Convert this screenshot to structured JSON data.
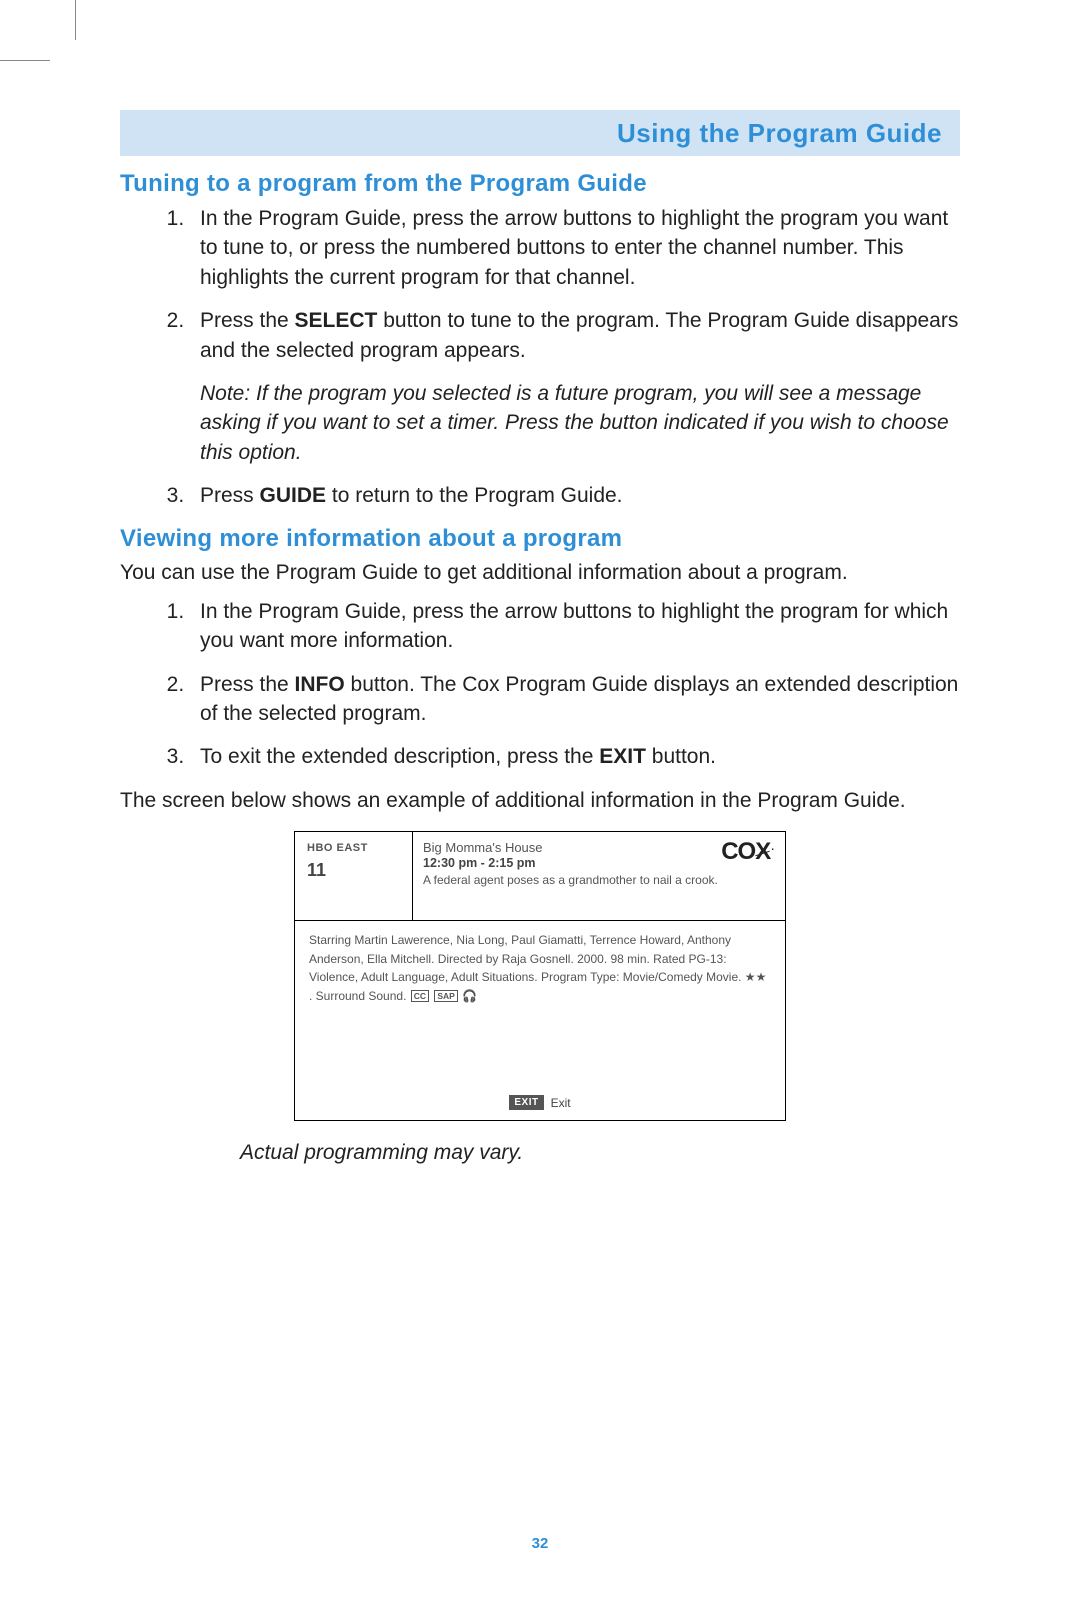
{
  "header": {
    "title": "Using the Program Guide"
  },
  "section1": {
    "heading": "Tuning to a program from the Program Guide",
    "step1": "In the Program Guide, press the arrow buttons to highlight the program you want to tune to, or press the numbered buttons to enter the channel number. This highlights the current program for that channel.",
    "step2_a": "Press the ",
    "step2_bold": "SELECT",
    "step2_b": " button to tune to the program. The Program Guide disappears and the selected program appears.",
    "note": "Note: If the program you selected is a future program, you will see a message asking if you want to set a timer. Press the button indicated if you wish to choose this option.",
    "step3_a": "Press ",
    "step3_bold": "GUIDE",
    "step3_b": " to return to the Program Guide."
  },
  "section2": {
    "heading": "Viewing more information about a program",
    "intro": "You can use the Program Guide to get additional information about a program.",
    "step1": "In the Program Guide, press the arrow buttons to highlight the program for which you want more information.",
    "step2_a": "Press the ",
    "step2_bold": "INFO",
    "step2_b": " button. The Cox Program Guide displays an extended description of the selected program.",
    "step3_a": "To exit the extended description, press the ",
    "step3_bold": "EXIT",
    "step3_b": " button.",
    "below": "The screen below shows an example of additional information in the Program Guide."
  },
  "panel": {
    "channel_name": "HBO EAST",
    "channel_num": "11",
    "logo_text": "COX",
    "prog_title": "Big Momma's House",
    "prog_time": "12:30 pm - 2:15 pm",
    "prog_desc": "A federal agent poses as a grandmother to nail a crook.",
    "body": "Starring Martin Lawerence, Nia Long, Paul Giamatti, Terrence Howard, Anthony Anderson, Ella Mitchell. Directed by Raja Gosnell. 2000. 98 min. Rated PG-13: Violence, Adult Language, Adult Situations. Program Type: Movie/Comedy Movie. ★★ . Surround Sound. ",
    "cc": "CC",
    "sap": "SAP",
    "headphone": "♫",
    "exit_badge": "EXIT",
    "exit_label": "Exit"
  },
  "caption": "Actual programming may vary.",
  "page_number": "32"
}
